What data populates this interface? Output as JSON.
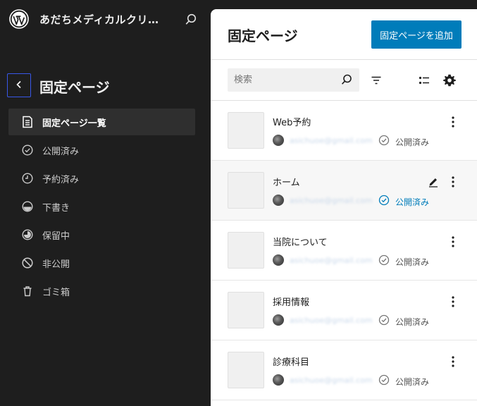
{
  "site": {
    "title": "あだちメディカルクリ…"
  },
  "sidebar": {
    "title": "固定ページ",
    "items": [
      {
        "label": "固定ページ一覧",
        "icon": "pages-icon",
        "active": true
      },
      {
        "label": "公開済み",
        "icon": "published-icon"
      },
      {
        "label": "予約済み",
        "icon": "scheduled-icon"
      },
      {
        "label": "下書き",
        "icon": "draft-icon"
      },
      {
        "label": "保留中",
        "icon": "pending-icon"
      },
      {
        "label": "非公開",
        "icon": "private-icon"
      },
      {
        "label": "ゴミ箱",
        "icon": "trash-icon"
      }
    ]
  },
  "main": {
    "heading": "固定ページ",
    "add_button": "固定ページを追加",
    "search": {
      "placeholder": "検索",
      "value": ""
    },
    "pages": [
      {
        "title": "Web予約",
        "author": "asichuoe@gmail.com",
        "status": "公開済み"
      },
      {
        "title": "ホーム",
        "author": "asichuoe@gmail.com",
        "status": "公開済み",
        "hovered": true
      },
      {
        "title": "当院について",
        "author": "asichuoe@gmail.com",
        "status": "公開済み"
      },
      {
        "title": "採用情報",
        "author": "asichuoe@gmail.com",
        "status": "公開済み"
      },
      {
        "title": "診療科目",
        "author": "asichuoe@gmail.com",
        "status": "公開済み"
      }
    ]
  },
  "colors": {
    "accent": "#007cba",
    "focus": "#3858e9",
    "sidebar_bg": "#1e1e1e"
  }
}
